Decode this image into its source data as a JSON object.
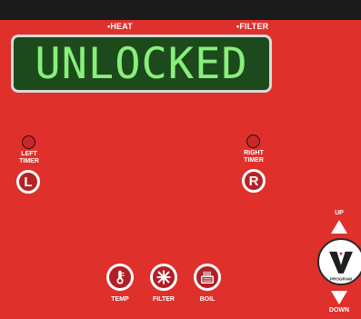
{
  "indicators": {
    "heat_label": "HEAT",
    "filter_label": "FILTER"
  },
  "display": {
    "text": "UNLOCKED"
  },
  "timers": {
    "left": {
      "label_line1": "LEFT",
      "label_line2": "TIMER",
      "button": "L"
    },
    "right": {
      "label_line1": "RIGHT",
      "label_line2": "TIMER",
      "button": "R"
    }
  },
  "functions": {
    "temp": "TEMP",
    "filter": "FILTER",
    "boil": "BOIL"
  },
  "program_control": {
    "up_label": "UP",
    "down_label": "DOWN",
    "knob_letter": "V",
    "knob_label": "PROGRAM"
  },
  "icons": {
    "temp": "thermometer-icon",
    "filter": "filter-icon",
    "boil": "boil-icon"
  },
  "colors": {
    "panel_red": "#e0302c",
    "display_green": "#1d4a1c",
    "display_text": "#88f07a"
  }
}
